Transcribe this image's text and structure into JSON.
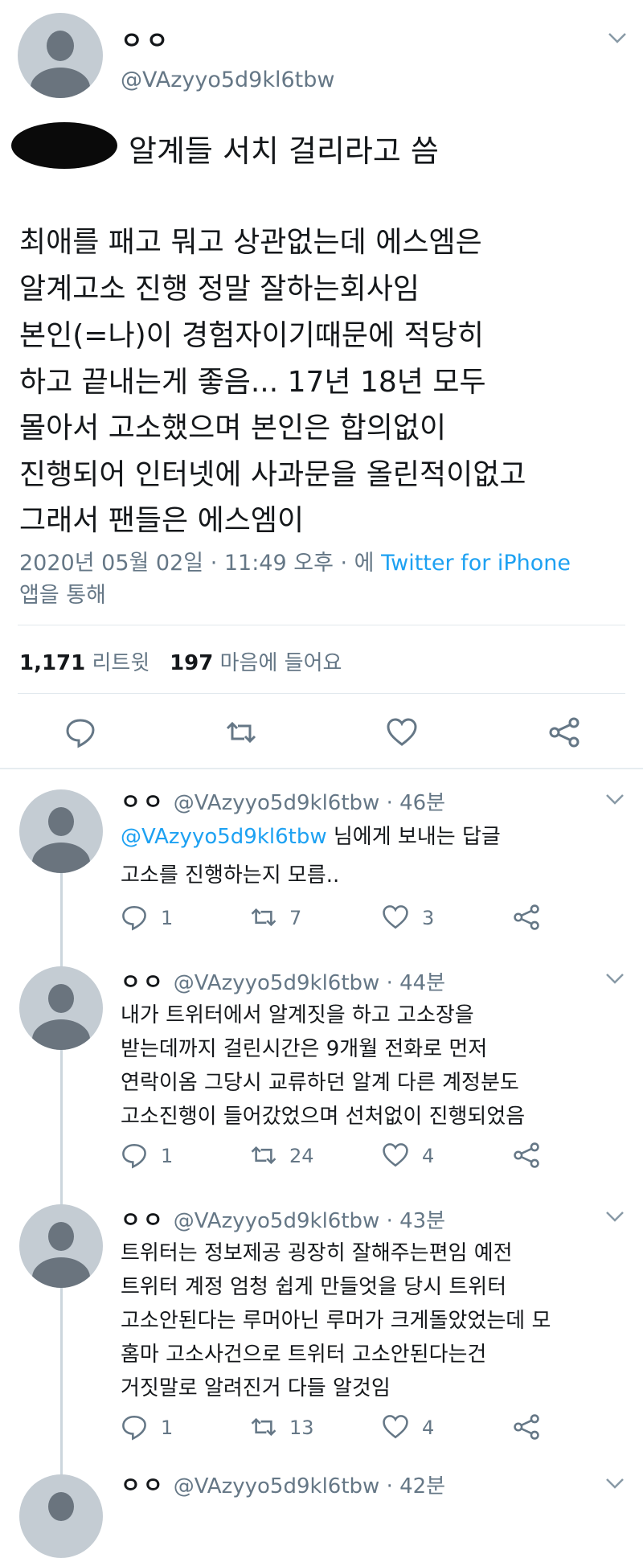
{
  "tweet": {
    "name": "ㅇㅇ",
    "handle": "@VAzyyo5d9kl6tbw",
    "caption": "알계들 서치 걸리라고 씀",
    "lines": [
      "최애를 패고 뭐고 상관없는데 에스엠은",
      "알계고소 진행 정말 잘하는회사임",
      "본인(=나)이 경험자이기때문에 적당히",
      "하고 끝내는게 좋음... 17년 18년 모두",
      "몰아서 고소했으며 본인은 합의없이",
      "진행되어 인터넷에 사과문을 올린적이없고",
      "그래서 팬들은 에스엠이"
    ],
    "timestamp": "2020년 05월 02일 · 11:49 오후 · 에 ",
    "source": "Twitter for iPhone",
    "source_suffix": "앱을 통해",
    "retweets": "1,171",
    "retweets_label": "리트윗",
    "likes": "197",
    "likes_label": "마음에 들어요"
  },
  "replies": [
    {
      "name": "ㅇㅇ",
      "handle": "@VAzyyo5d9kl6tbw · 46분",
      "reply_to_handle": "@VAzyyo5d9kl6tbw",
      "reply_to_suffix": " 님에게 보내는 답글",
      "lines": [
        "고소를 진행하는지 모름.."
      ],
      "replies": "1",
      "retweets": "7",
      "likes": "3"
    },
    {
      "name": "ㅇㅇ",
      "handle": "@VAzyyo5d9kl6tbw · 44분",
      "lines": [
        "내가 트위터에서 알계짓을 하고 고소장을",
        "받는데까지 걸린시간은 9개월 전화로 먼저",
        "연락이옴 그당시 교류하던 알계 다른 계정분도",
        "고소진행이 들어갔었으며 선처없이 진행되었음"
      ],
      "replies": "1",
      "retweets": "24",
      "likes": "4"
    },
    {
      "name": "ㅇㅇ",
      "handle": "@VAzyyo5d9kl6tbw · 43분",
      "lines": [
        "트위터는 정보제공 굉장히 잘해주는편임 예전",
        "트위터 계정 엄청 쉽게 만들엇을 당시 트위터",
        "고소안된다는 루머아닌 루머가 크게돌았었는데 모",
        "홈마 고소사건으로 트위터 고소안된다는건",
        "거짓말로 알려진거 다들 알것임"
      ],
      "replies": "1",
      "retweets": "13",
      "likes": "4"
    },
    {
      "name": "ㅇㅇ",
      "handle": "@VAzyyo5d9kl6tbw · 42분"
    }
  ],
  "icons": [
    "reply-icon",
    "retweet-icon",
    "like-icon",
    "share-icon",
    "chevron-down-icon",
    "avatar"
  ],
  "colors": {
    "link": "#1da1f2",
    "muted": "#657786",
    "divider": "#e1e8ed",
    "thread": "#ccd6dd"
  }
}
